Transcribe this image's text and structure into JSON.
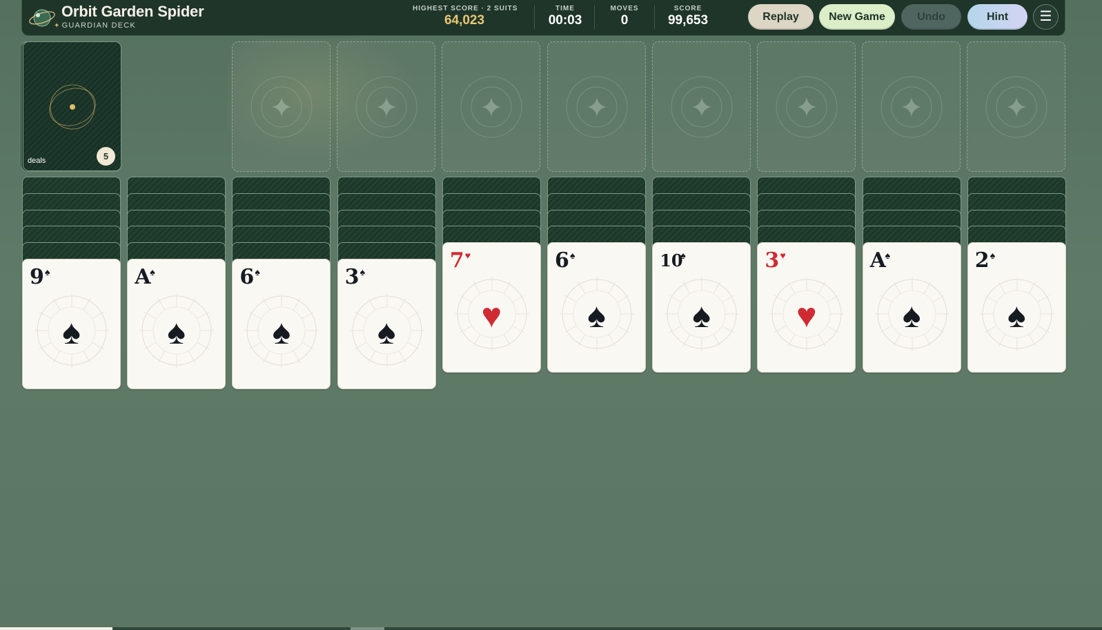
{
  "header": {
    "title": "Orbit Garden Spider",
    "subtitle": "GUARDIAN DECK",
    "stats": {
      "best": {
        "label": "HIGHEST SCORE · 2 SUITS",
        "value": "64,023"
      },
      "time": {
        "label": "TIME",
        "value": "00:03"
      },
      "moves": {
        "label": "MOVES",
        "value": "0"
      },
      "score": {
        "label": "SCORE",
        "value": "99,653"
      }
    },
    "buttons": {
      "replay": "Replay",
      "new_game": "New Game",
      "undo": "Undo",
      "hint": "Hint",
      "menu": "☰"
    }
  },
  "stock": {
    "label": "deals",
    "count": "5"
  },
  "foundations": {
    "count": 8,
    "icon": "four-point-star-icon"
  },
  "tableau": [
    {
      "face_down": 5,
      "top": {
        "rank": "9",
        "suit": "♠",
        "color": "black"
      }
    },
    {
      "face_down": 5,
      "top": {
        "rank": "A",
        "suit": "♠",
        "color": "black"
      }
    },
    {
      "face_down": 5,
      "top": {
        "rank": "6",
        "suit": "♠",
        "color": "black"
      }
    },
    {
      "face_down": 5,
      "top": {
        "rank": "3",
        "suit": "♠",
        "color": "black"
      }
    },
    {
      "face_down": 4,
      "top": {
        "rank": "7",
        "suit": "♥",
        "color": "red"
      }
    },
    {
      "face_down": 4,
      "top": {
        "rank": "6",
        "suit": "♠",
        "color": "black"
      }
    },
    {
      "face_down": 4,
      "top": {
        "rank": "10",
        "suit": "♠",
        "color": "black"
      }
    },
    {
      "face_down": 4,
      "top": {
        "rank": "3",
        "suit": "♥",
        "color": "red"
      }
    },
    {
      "face_down": 4,
      "top": {
        "rank": "A",
        "suit": "♠",
        "color": "black"
      }
    },
    {
      "face_down": 4,
      "top": {
        "rank": "2",
        "suit": "♠",
        "color": "black"
      }
    }
  ],
  "colors": {
    "felt": "#5b7663",
    "header": "#1f3529",
    "red_suit": "#d02a33",
    "black_suit": "#161b22",
    "accent_gold": "#e8c772"
  }
}
